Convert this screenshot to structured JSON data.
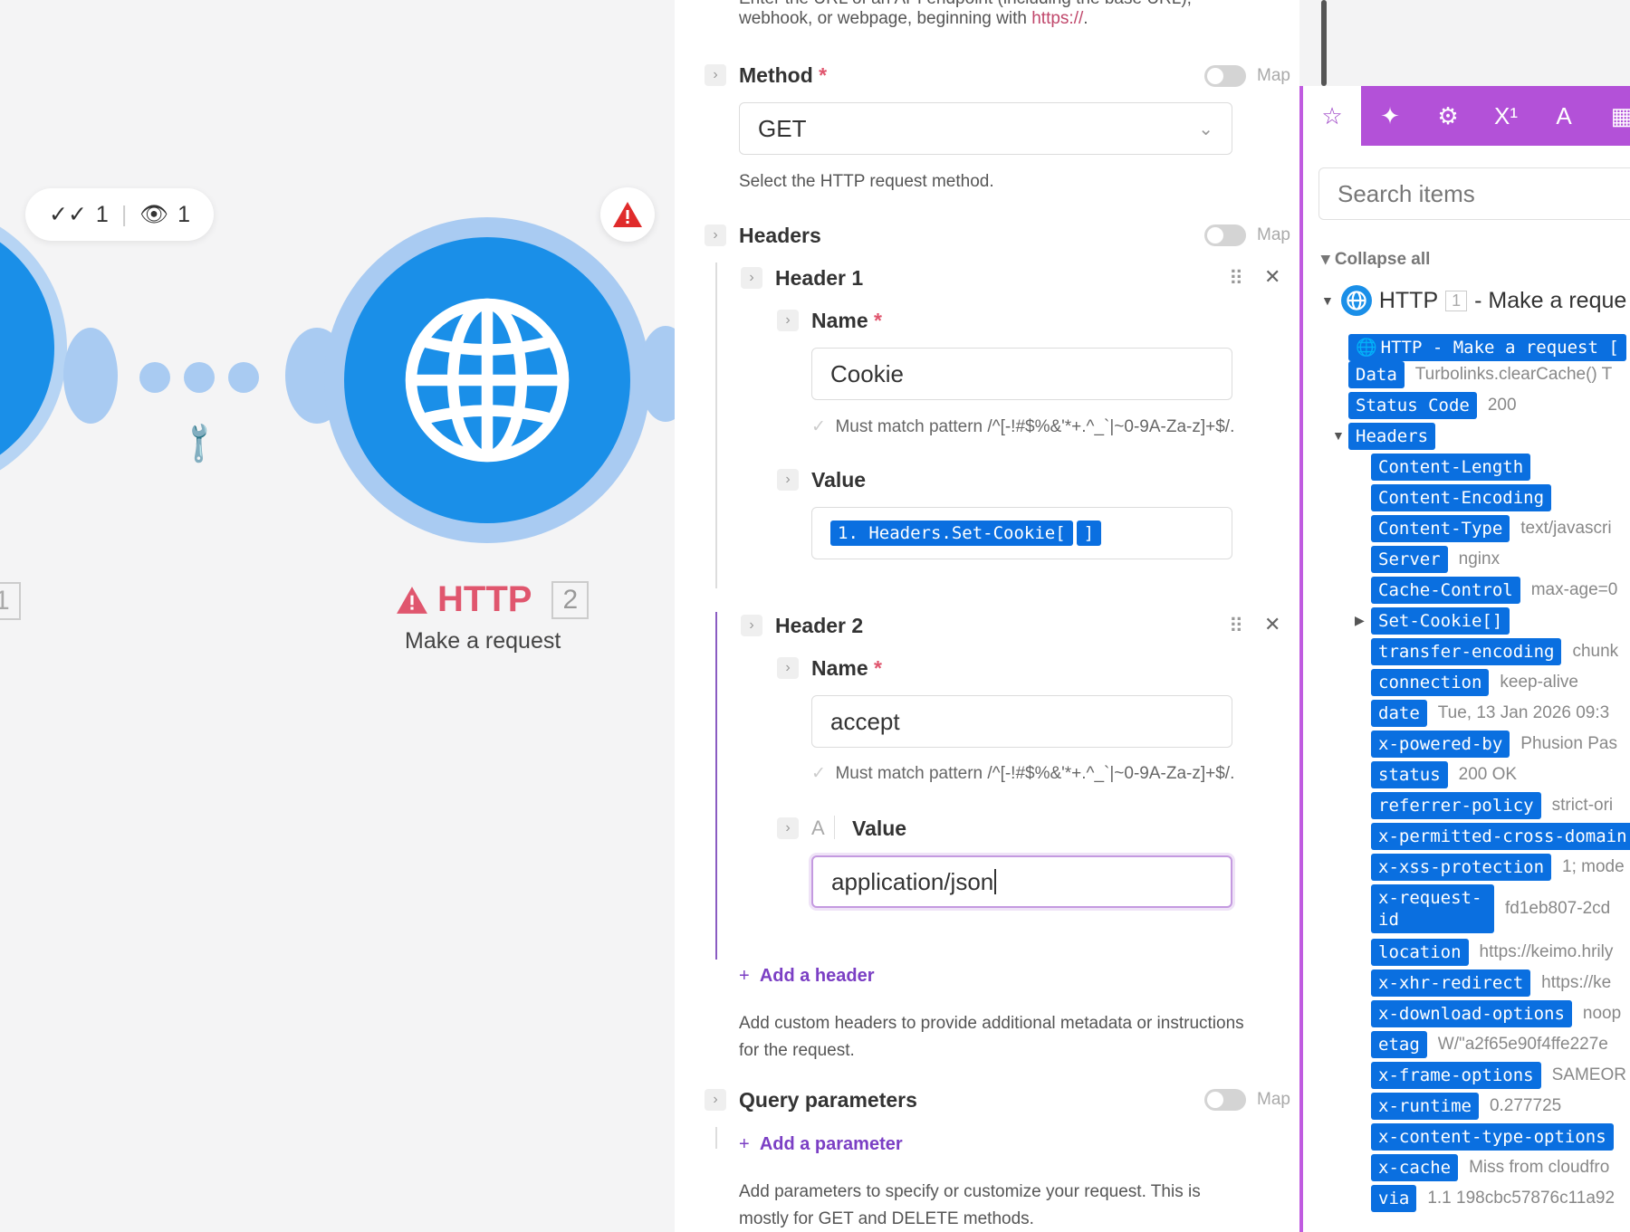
{
  "canvas": {
    "stats": {
      "check_count": "1",
      "view_count": "1"
    },
    "left_module_num": "1",
    "http_module": {
      "name": "HTTP",
      "num": "2",
      "subtitle": "Make a request"
    }
  },
  "form": {
    "top_hint_line1": "Enter the URL of an API endpoint (including the base URL),",
    "top_hint_line2": "webhook, or webpage, beginning with ",
    "top_hint_code": "https://",
    "top_hint_end": ".",
    "method": {
      "label": "Method",
      "value": "GET",
      "hint": "Select the HTTP request method.",
      "map": "Map"
    },
    "headers": {
      "label": "Headers",
      "map": "Map",
      "header1": {
        "title": "Header 1",
        "name_label": "Name",
        "name_value": "Cookie",
        "pattern": "Must match pattern /^[-!#$%&'*+.^_`|~0-9A-Za-z]+$/.",
        "value_label": "Value",
        "value_pill": "1. Headers.Set-Cookie[",
        "value_pill_end": "]"
      },
      "header2": {
        "title": "Header 2",
        "name_label": "Name",
        "name_value": "accept",
        "pattern": "Must match pattern /^[-!#$%&'*+.^_`|~0-9A-Za-z]+$/.",
        "value_label": "Value",
        "value_icon": "A",
        "value_text": "application/json"
      },
      "add": "Add a header",
      "hint_line1": "Add custom headers to provide additional metadata or instructions",
      "hint_line2": "for the request."
    },
    "query": {
      "label": "Query parameters",
      "map": "Map",
      "add": "Add a parameter",
      "hint_line1": "Add parameters to specify or customize your request. This is",
      "hint_line2": "mostly for GET and DELETE methods."
    }
  },
  "mapper": {
    "tabs": [
      {
        "icon": "star-icon",
        "glyph": "☆"
      },
      {
        "icon": "sparkle-icon",
        "glyph": "✦"
      },
      {
        "icon": "gear-icon",
        "glyph": "⚙"
      },
      {
        "icon": "superscript-icon",
        "glyph": "X¹"
      },
      {
        "icon": "text-icon",
        "glyph": "A"
      },
      {
        "icon": "calendar-icon",
        "glyph": "▦"
      }
    ],
    "search_placeholder": "Search items",
    "collapse_all": "Collapse all",
    "module": {
      "name": "HTTP",
      "num": "1",
      "action": "- Make a reque"
    },
    "root_pill": "HTTP - Make a request [",
    "items": [
      {
        "key": "Data",
        "value": "Turbolinks.clearCache() T"
      },
      {
        "key": "Status Code",
        "value": "200"
      },
      {
        "key": "Headers",
        "value": ""
      },
      {
        "key": "Content-Length",
        "value": ""
      },
      {
        "key": "Content-Encoding",
        "value": ""
      },
      {
        "key": "Content-Type",
        "value": "text/javascri"
      },
      {
        "key": "Server",
        "value": "nginx"
      },
      {
        "key": "Cache-Control",
        "value": "max-age=0"
      },
      {
        "key": "Set-Cookie[]",
        "value": ""
      },
      {
        "key": "transfer-encoding",
        "value": "chunk"
      },
      {
        "key": "connection",
        "value": "keep-alive"
      },
      {
        "key": "date",
        "value": "Tue, 13 Jan 2026 09:3"
      },
      {
        "key": "x-powered-by",
        "value": "Phusion Pas"
      },
      {
        "key": "status",
        "value": "200 OK"
      },
      {
        "key": "referrer-policy",
        "value": "strict-ori"
      },
      {
        "key": "x-permitted-cross-domain",
        "value": ""
      },
      {
        "key": "x-xss-protection",
        "value": "1; mode"
      },
      {
        "key": "x-request-",
        "key2": "id",
        "value": "fd1eb807-2cd"
      },
      {
        "key": "location",
        "value": "https://keimo.hrily"
      },
      {
        "key": "x-xhr-redirect",
        "value": "https://ke"
      },
      {
        "key": "x-download-options",
        "value": "noop"
      },
      {
        "key": "etag",
        "value": "W/\"a2f65e90f4ffe227e"
      },
      {
        "key": "x-frame-options",
        "value": "SAMEOR"
      },
      {
        "key": "x-runtime",
        "value": "0.277725"
      },
      {
        "key": "x-content-type-options",
        "value": ""
      },
      {
        "key": "x-cache",
        "value": "Miss from cloudfro"
      },
      {
        "key": "via",
        "value": "1.1 198cbc57876c11a92"
      }
    ]
  },
  "colors": {
    "accent": "#b351d8",
    "module_blue": "#1a8fe8",
    "pill_blue": "#0a6fe0",
    "warn_red": "#e0566e"
  }
}
